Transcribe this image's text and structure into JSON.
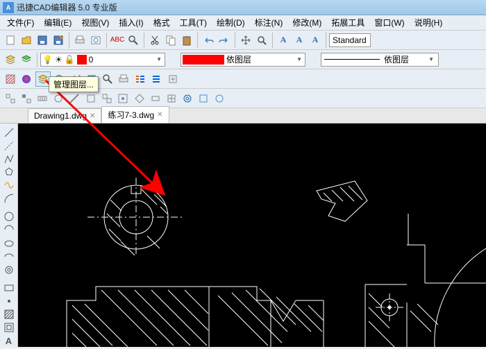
{
  "title": "迅捷CAD编辑器 5.0 专业版",
  "menu": [
    "文件(F)",
    "编辑(E)",
    "视图(V)",
    "插入(I)",
    "格式",
    "工具(T)",
    "绘制(D)",
    "标注(N)",
    "修改(M)",
    "拓展工具",
    "窗口(W)",
    "说明(H)"
  ],
  "tooltip": "管理图层...",
  "layer": {
    "name": "0"
  },
  "linetype": "依图层",
  "lineweight": "依图层",
  "textstyle": "Standard",
  "tabs": [
    {
      "label": "Drawing1.dwg",
      "active": false
    },
    {
      "label": "练习7-3.dwg",
      "active": true
    }
  ]
}
